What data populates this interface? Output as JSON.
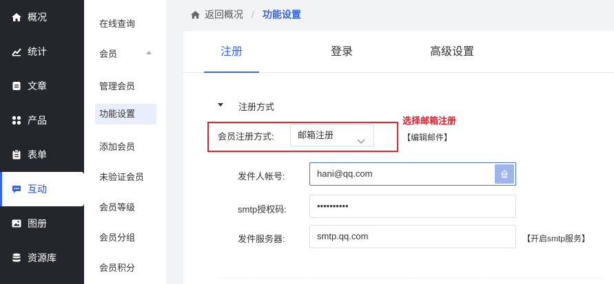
{
  "sidebar": {
    "items": [
      {
        "label": "概况",
        "icon": "home-icon"
      },
      {
        "label": "统计",
        "icon": "chart-icon"
      },
      {
        "label": "文章",
        "icon": "document-icon"
      },
      {
        "label": "产品",
        "icon": "grid-icon"
      },
      {
        "label": "表单",
        "icon": "clipboard-icon"
      },
      {
        "label": "互动",
        "icon": "chat-icon",
        "active": true
      },
      {
        "label": "图册",
        "icon": "image-icon"
      },
      {
        "label": "资源库",
        "icon": "database-icon"
      }
    ]
  },
  "subnav": {
    "items": [
      "在线查询",
      "会员",
      "管理会员",
      "功能设置",
      "添加会员",
      "未验证会员",
      "会员等级",
      "会员分组",
      "会员积分"
    ],
    "active": "功能设置"
  },
  "breadcrumb": {
    "back": "返回概况",
    "separator": "/",
    "current": "功能设置"
  },
  "tabs": [
    "注册",
    "登录",
    "高级设置"
  ],
  "form": {
    "section_title": "注册方式",
    "reg_method_label": "会员注册方式:",
    "reg_method_value": "邮箱注册",
    "annotation": "选择邮箱注册",
    "edit_mail_link": "【编辑邮件】",
    "sender_label": "发件人帐号:",
    "sender_value": "hani@qq.com",
    "smtp_code_label": "smtp授权码:",
    "smtp_code_value": "••••••••••",
    "server_label": "发件服务器:",
    "server_value": "smtp.qq.com",
    "smtp_service_link": "【开启smtp服务】"
  },
  "colors": {
    "sidebar_bg": "#23262b",
    "accent": "#3a66d8",
    "annotation_red": "#d9232e"
  }
}
